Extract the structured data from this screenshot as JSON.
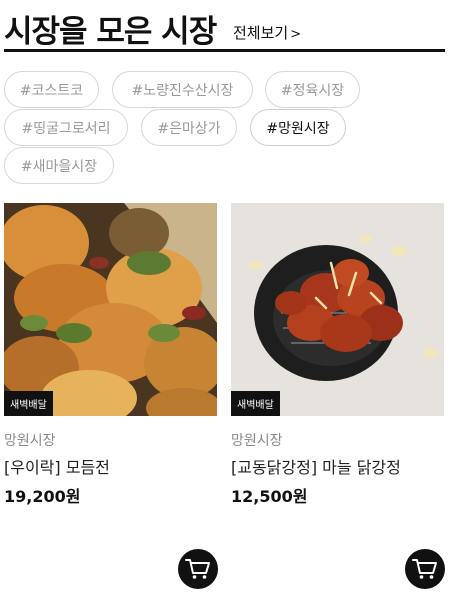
{
  "section": {
    "title": "시장을 모은 시장",
    "view_all_label": "전체보기",
    "view_all_arrow": ">"
  },
  "tags": [
    {
      "label": "#코스트코",
      "active": false
    },
    {
      "label": "#노량진수산시장",
      "active": false
    },
    {
      "label": "#정육시장",
      "active": false
    },
    {
      "label": "#띵굴그로서리",
      "active": false
    },
    {
      "label": "#은마상가",
      "active": false
    },
    {
      "label": "#망원시장",
      "active": true
    },
    {
      "label": "#새마을시장",
      "active": false
    }
  ],
  "products": [
    {
      "badge": "새벽배달",
      "market": "망원시장",
      "name": "[우이락] 모듬전",
      "price": "19,200원",
      "image_icon": "fried-pancake-photo"
    },
    {
      "badge": "새벽배달",
      "market": "망원시장",
      "name": "[교동닭강정] 마늘 닭강정",
      "price": "12,500원",
      "image_icon": "fried-chicken-photo"
    }
  ],
  "colors": {
    "accent": "#111111",
    "muted_text": "#8a8a8a",
    "tag_border": "#d8d8d8"
  }
}
